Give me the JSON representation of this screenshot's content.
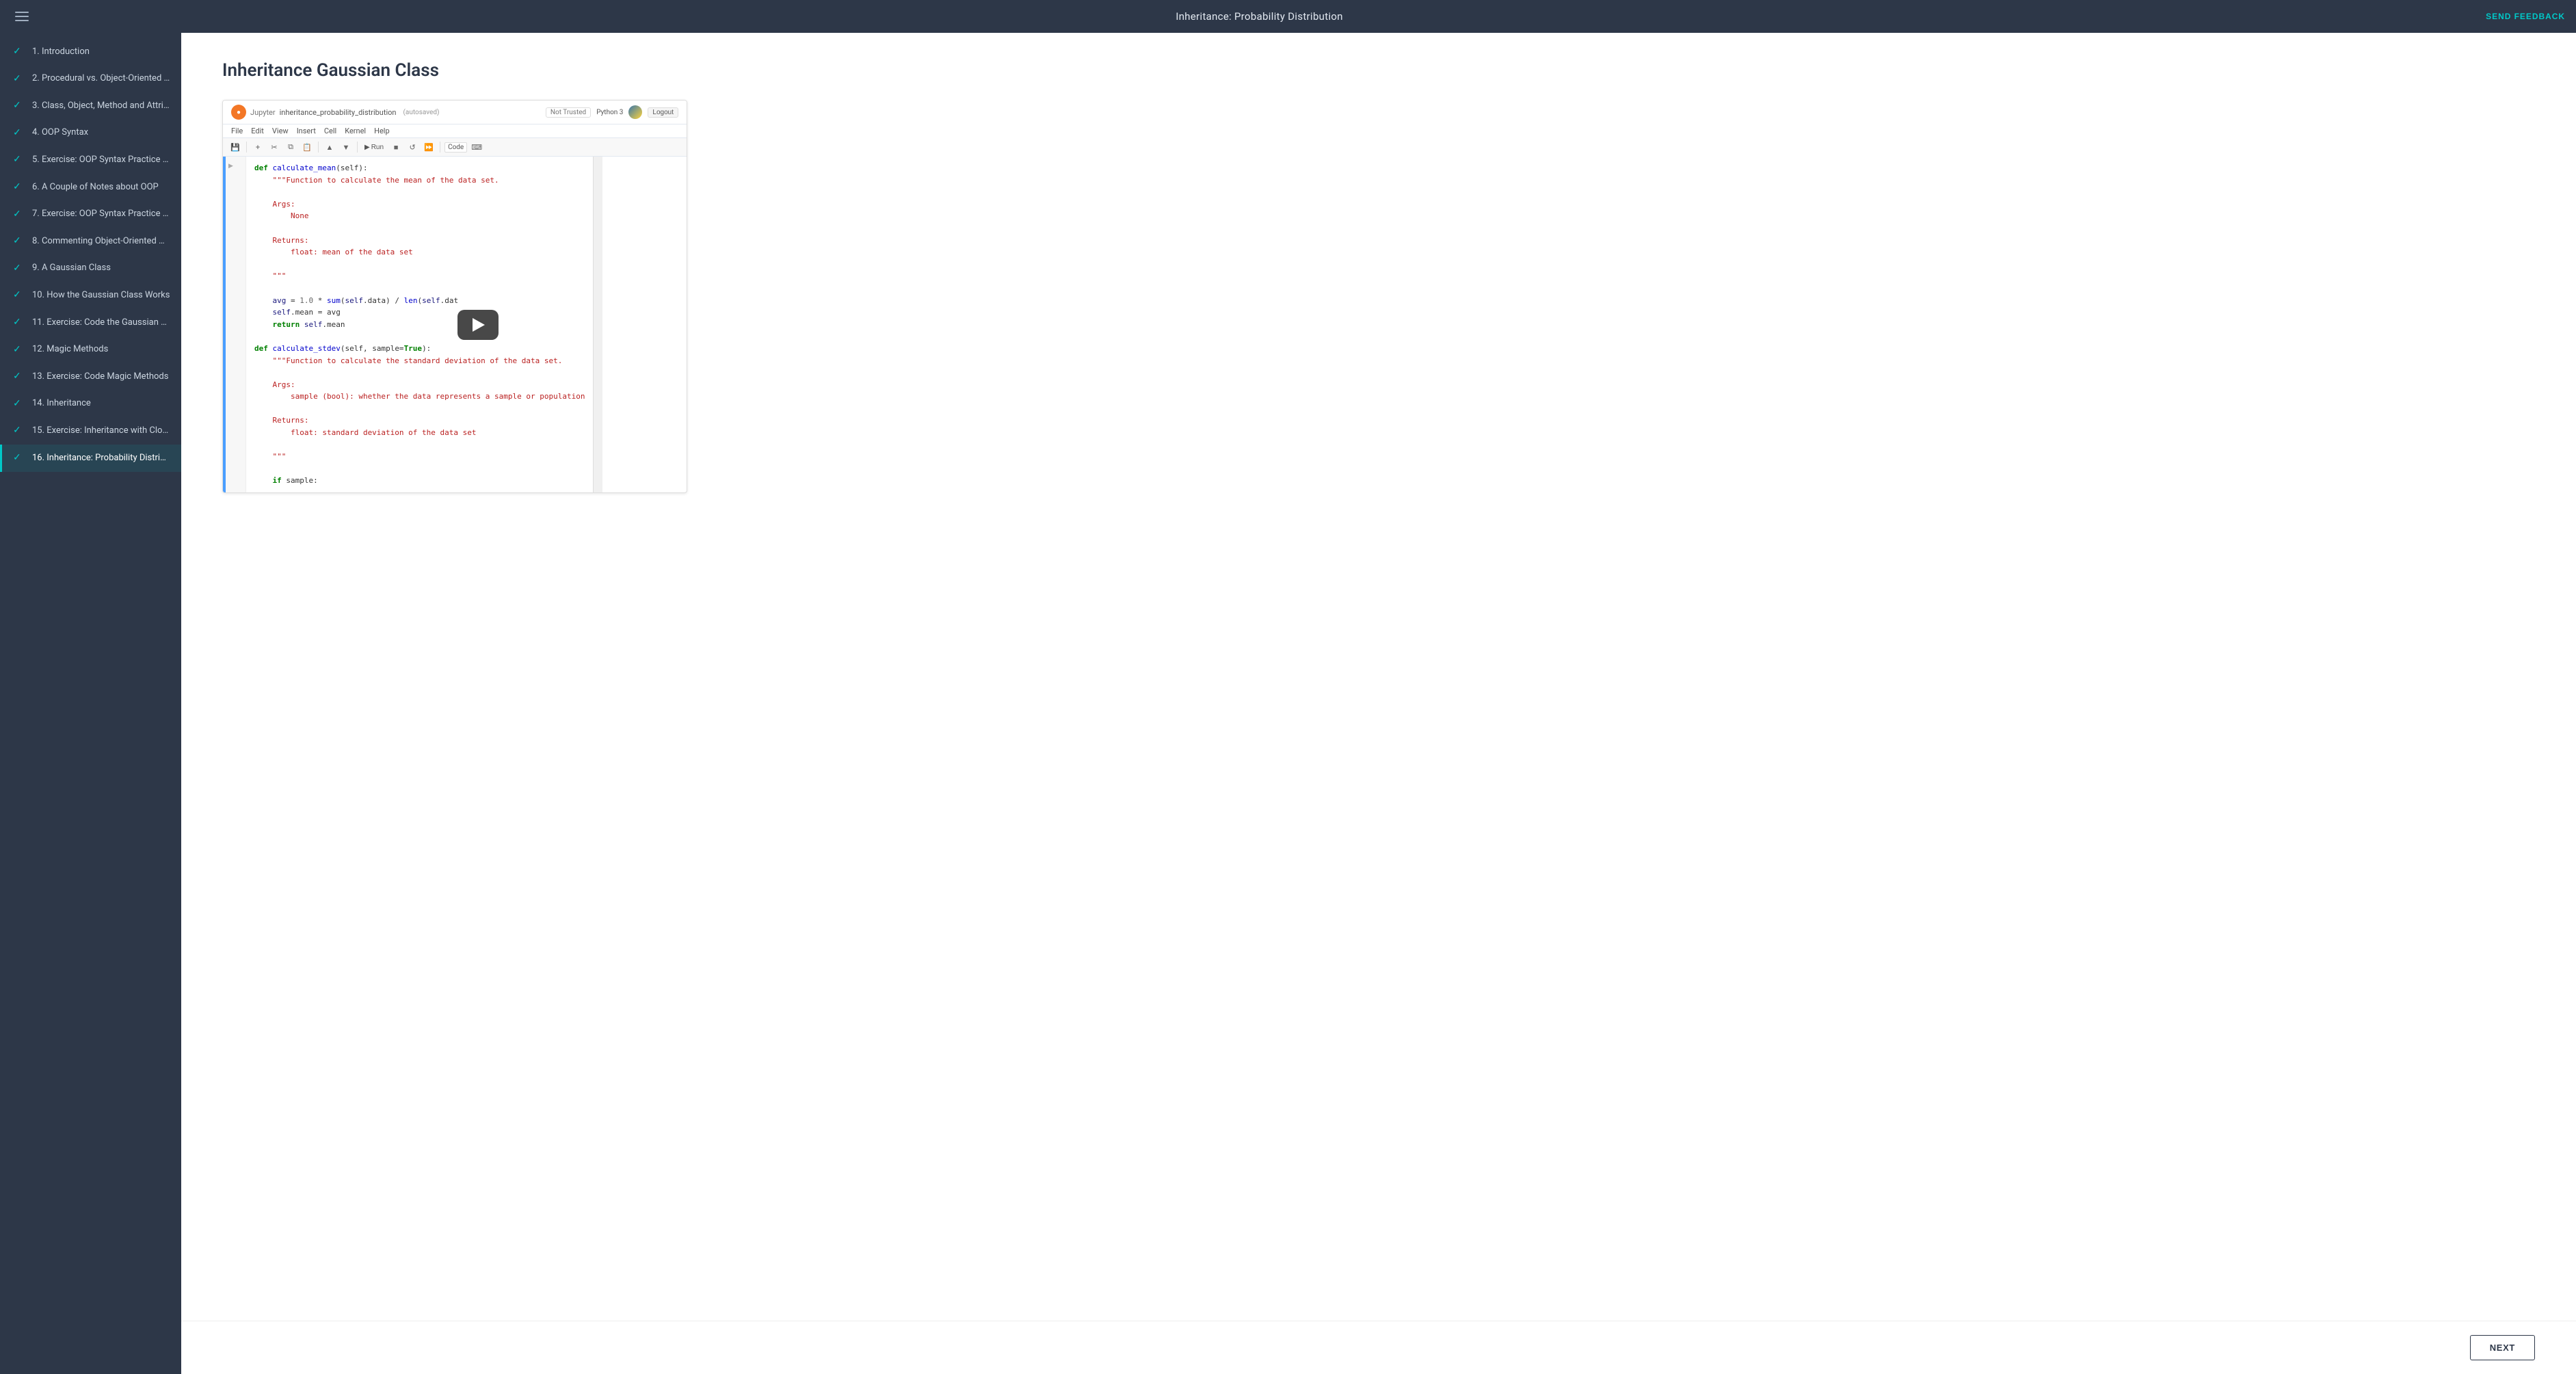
{
  "header": {
    "title": "Inheritance: Probability Distribution",
    "send_feedback_label": "SEND FEEDBACK"
  },
  "sidebar": {
    "items": [
      {
        "id": 1,
        "label": "1. Introduction",
        "checked": true,
        "active": false
      },
      {
        "id": 2,
        "label": "2. Procedural vs. Object-Oriented P...",
        "checked": true,
        "active": false
      },
      {
        "id": 3,
        "label": "3. Class, Object, Method and Attrib...",
        "checked": true,
        "active": false
      },
      {
        "id": 4,
        "label": "4. OOP Syntax",
        "checked": true,
        "active": false
      },
      {
        "id": 5,
        "label": "5. Exercise: OOP Syntax Practice - P...",
        "checked": true,
        "active": false
      },
      {
        "id": 6,
        "label": "6. A Couple of Notes about OOP",
        "checked": true,
        "active": false
      },
      {
        "id": 7,
        "label": "7. Exercise: OOP Syntax Practice - P...",
        "checked": true,
        "active": false
      },
      {
        "id": 8,
        "label": "8. Commenting Object-Oriented Co...",
        "checked": true,
        "active": false
      },
      {
        "id": 9,
        "label": "9. A Gaussian Class",
        "checked": true,
        "active": false
      },
      {
        "id": 10,
        "label": "10. How the Gaussian Class Works",
        "checked": true,
        "active": false
      },
      {
        "id": 11,
        "label": "11. Exercise: Code the Gaussian Cla...",
        "checked": true,
        "active": false
      },
      {
        "id": 12,
        "label": "12. Magic Methods",
        "checked": true,
        "active": false
      },
      {
        "id": 13,
        "label": "13. Exercise: Code Magic Methods",
        "checked": true,
        "active": false
      },
      {
        "id": 14,
        "label": "14. Inheritance",
        "checked": true,
        "active": false
      },
      {
        "id": 15,
        "label": "15. Exercise: Inheritance with Clothi...",
        "checked": true,
        "active": false
      },
      {
        "id": 16,
        "label": "16. Inheritance: Probability Distrib...",
        "checked": true,
        "active": true
      }
    ]
  },
  "page": {
    "title": "Inheritance Gaussian Class"
  },
  "jupyter": {
    "filename": "inheritance_probability_distribution",
    "autosaved": "(autosaved)",
    "menus": [
      "File",
      "Edit",
      "View",
      "Insert",
      "Cell",
      "Kernel",
      "Help"
    ],
    "not_trusted": "Not Trusted",
    "python_version": "Python 3",
    "logout": "Logout",
    "cell_type": "Code",
    "run_label": "Run"
  },
  "next_button": {
    "label": "NEXT"
  },
  "code_content": {
    "line1": "def calculate_mean(self):",
    "line2": "    \"\"\"Function to calculate the mean of the data set.",
    "line3": "",
    "line4": "    Args:",
    "line5": "        None",
    "line6": "",
    "line7": "    Returns:",
    "line8": "        float: mean of the data set",
    "line9": "",
    "line10": "    \"\"\"",
    "line11": "",
    "line12": "    avg = 1.0 * sum(self.data) / len(self.dat",
    "line13": "    self.mean = avg",
    "line14": "    return self.mean",
    "line15": "",
    "line16": "def calculate_stdev(self, sample=True):",
    "line17": "    \"\"\"Function to calculate the standard deviation of the data set.",
    "line18": "",
    "line19": "    Args:",
    "line20": "        sample (bool): whether the data represents a sample or population",
    "line21": "",
    "line22": "    Returns:",
    "line23": "        float: standard deviation of the data set",
    "line24": "",
    "line25": "    \"\"\"",
    "line26": "",
    "line27": "    if sample:"
  }
}
